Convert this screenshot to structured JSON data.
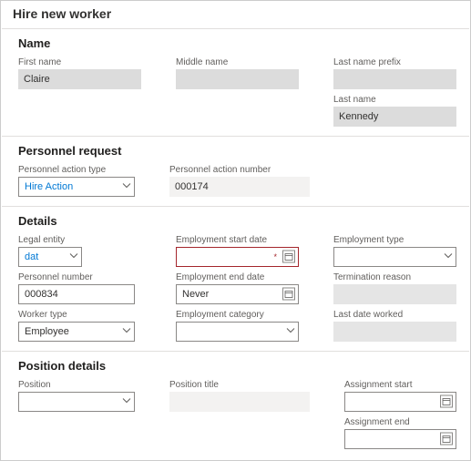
{
  "page_title": "Hire new worker",
  "name_section": {
    "title": "Name",
    "first_name_label": "First name",
    "first_name": "Claire",
    "middle_name_label": "Middle name",
    "middle_name": "",
    "last_name_prefix_label": "Last name prefix",
    "last_name_prefix": "",
    "last_name_label": "Last name",
    "last_name": "Kennedy"
  },
  "personnel_section": {
    "title": "Personnel request",
    "action_type_label": "Personnel action type",
    "action_type": "Hire Action",
    "action_number_label": "Personnel action number",
    "action_number": "000174"
  },
  "details_section": {
    "title": "Details",
    "legal_entity_label": "Legal entity",
    "legal_entity": "dat",
    "start_date_label": "Employment start date",
    "start_date": "",
    "employment_type_label": "Employment type",
    "employment_type": "",
    "personnel_number_label": "Personnel number",
    "personnel_number": "000834",
    "end_date_label": "Employment end date",
    "end_date": "Never",
    "termination_reason_label": "Termination reason",
    "termination_reason": "",
    "worker_type_label": "Worker type",
    "worker_type": "Employee",
    "employment_category_label": "Employment category",
    "employment_category": "",
    "last_date_worked_label": "Last date worked",
    "last_date_worked": ""
  },
  "position_section": {
    "title": "Position details",
    "position_label": "Position",
    "position": "",
    "position_title_label": "Position title",
    "position_title": "",
    "assignment_start_label": "Assignment start",
    "assignment_start": "",
    "assignment_end_label": "Assignment end",
    "assignment_end": ""
  }
}
